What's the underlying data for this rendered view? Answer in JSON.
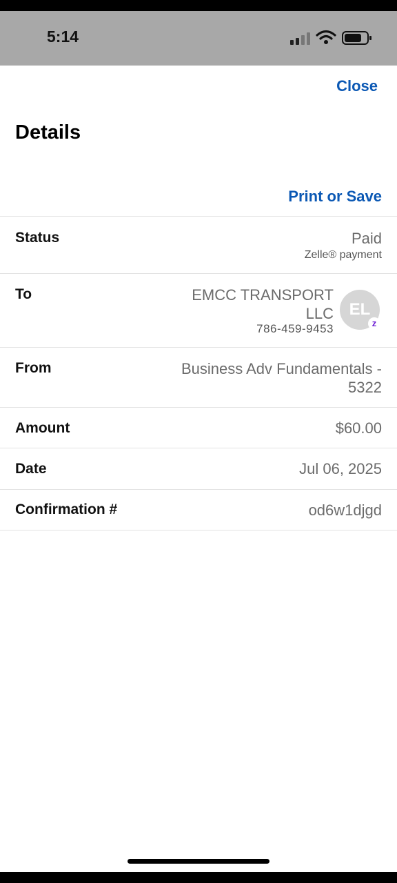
{
  "status_bar": {
    "time": "5:14",
    "icons": [
      "cellular-signal-icon",
      "wifi-icon",
      "battery-icon"
    ]
  },
  "header": {
    "close_label": "Close",
    "title": "Details",
    "print_label": "Print or Save"
  },
  "details": {
    "status": {
      "label": "Status",
      "value": "Paid",
      "sub": "Zelle® payment"
    },
    "to": {
      "label": "To",
      "name": "EMCC TRANSPORT LLC",
      "phone": "786-459-9453",
      "avatar_initials": "EL",
      "badge": "z"
    },
    "from": {
      "label": "From",
      "value": "Business Adv Fundamentals - 5322"
    },
    "amount": {
      "label": "Amount",
      "value": "$60.00"
    },
    "date": {
      "label": "Date",
      "value": "Jul 06, 2025"
    },
    "confirmation": {
      "label": "Confirmation #",
      "value": "od6w1djgd"
    }
  },
  "colors": {
    "link": "#0b58b4",
    "status_bar_bg": "#a8a8a8",
    "value_text": "#6b6b6b",
    "zelle_purple": "#6d1ed4"
  }
}
